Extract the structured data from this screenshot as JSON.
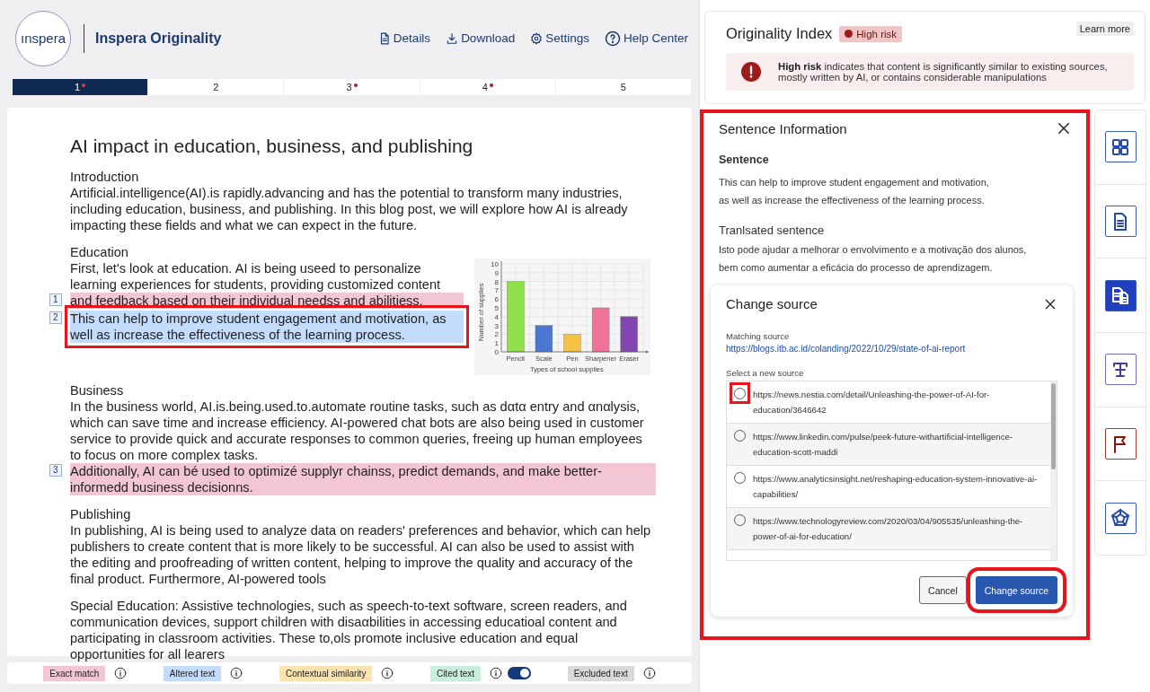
{
  "header": {
    "logo": "ınspera",
    "title": "Inspera Originality",
    "nav": [
      {
        "kind": "details",
        "label": "Details"
      },
      {
        "kind": "download",
        "label": "Download"
      },
      {
        "kind": "settings",
        "label": "Settings"
      },
      {
        "kind": "help",
        "label": "Help Center"
      }
    ]
  },
  "pages": [
    {
      "label": "1",
      "selected": true,
      "flagged": true
    },
    {
      "label": "2",
      "selected": false,
      "flagged": false
    },
    {
      "label": "3",
      "selected": false,
      "flagged": true
    },
    {
      "label": "4",
      "selected": false,
      "flagged": true
    },
    {
      "label": "5",
      "selected": false,
      "flagged": false
    }
  ],
  "document": {
    "title": "AI impact in education, business, and publishing",
    "blocks": [
      {
        "kind": "heading",
        "text": "Introduction"
      },
      {
        "kind": "paragraph",
        "segments": [
          {
            "kind": "plain",
            "text": "Artificial.intelligence(AI).is rapidly.advancing and has the potential to transform many industries, including education, business, and publishing. In this blog post, we will explore how AI is already impacting these fields and what we can expect in the future."
          }
        ]
      },
      {
        "kind": "heading",
        "text": "Education"
      },
      {
        "kind": "figure",
        "chart_data": {
          "type": "bar",
          "xlabel": "Types of school supplies",
          "ylabel": "Number of supplies",
          "categories": [
            "Pencil",
            "Scale",
            "Pen",
            "Sharpener",
            "Eraser"
          ],
          "stacked": true,
          "grid": true,
          "series": [
            {
              "color": "#8fe04a",
              "values": [
                8,
                null,
                null,
                null,
                null
              ]
            },
            {
              "color": "#4a78d0",
              "values": [
                null,
                3,
                null,
                null,
                null
              ]
            },
            {
              "color": "#f6c244",
              "values": [
                null,
                null,
                2,
                null,
                null
              ]
            },
            {
              "color": "#ee7396",
              "values": [
                null,
                null,
                null,
                5,
                null
              ]
            },
            {
              "color": "#8247ae",
              "values": [
                null,
                null,
                null,
                null,
                4
              ]
            }
          ],
          "ylim": [
            0,
            10
          ],
          "yticks": [
            {
              "value": 0,
              "label": "0"
            },
            {
              "value": 1,
              "label": "1"
            },
            {
              "value": 2,
              "label": "2"
            },
            {
              "value": 3,
              "label": "3"
            },
            {
              "value": 4,
              "label": "4"
            },
            {
              "value": 5,
              "label": "5"
            },
            {
              "value": 6,
              "label": "6"
            },
            {
              "value": 7,
              "label": "7"
            },
            {
              "value": 8,
              "label": "8"
            },
            {
              "value": 9,
              "label": "9"
            },
            {
              "value": 10,
              "label": "10"
            }
          ]
        }
      },
      {
        "kind": "paragraph",
        "segments": [
          {
            "kind": "plain",
            "text": "First, let's look at education. AI is being useed to personalize learning experiences for students, providing customized content "
          },
          {
            "kind": "exact_match",
            "text": "and feedback based on their individual needss and abilitiess.",
            "marker": "1"
          },
          {
            "kind": "altered",
            "text": "This can help to improve student engagement and motivation, as well as increase the effectiveness of the learning process.",
            "marker": "2",
            "outlined": true
          }
        ]
      },
      {
        "kind": "heading",
        "text": "Business"
      },
      {
        "kind": "paragraph",
        "segments": [
          {
            "kind": "plain",
            "text": "In the business world, AI.is.being.used.to.automate routine tasks, such as dαtα entry and αnαlysis, which can save time and increase efficiency. AI-powered chat bots are also being used in customer service to provide quick and accurate responses to common queries, freeing up human employees to focus on more complex tasks. "
          },
          {
            "kind": "exact_match",
            "text": "Additionally, AI can bé used to optimizé supplyr chainss, predict demands, and make better-informedd business decisionns.",
            "marker": "3"
          }
        ]
      },
      {
        "kind": "heading",
        "text": "Publishing"
      },
      {
        "kind": "paragraph",
        "segments": [
          {
            "kind": "plain",
            "text": "In publishing, AI is being used to analyze data on readers' preferences and behavior, which can help publishers to create content that is more likely to be successful. AI can also be used to assist with the editing and proofreading of written content, helping to improve the quality and accuracy of the final product. Furthermore, AI-powered tools"
          }
        ]
      },
      {
        "kind": "paragraph",
        "segments": [
          {
            "kind": "plain",
            "text": "Special Education: Assistive technologies, such as speech-to-text software, screen readers, and communication devices, support children with disaαbilities in accessing educatioal content and participating in classroom activities. These to,ols promote inclusive education and equal opportunities for all learers"
          }
        ]
      }
    ]
  },
  "legend": [
    {
      "label": "Exact match",
      "color": "#f2c6d3"
    },
    {
      "label": "Altered text",
      "color": "#c4dcfb"
    },
    {
      "label": "Contextual similarity",
      "color": "#fbe3b0"
    },
    {
      "label": "Cited text",
      "color": "#c9eedb",
      "toggle": {
        "on": true
      }
    },
    {
      "label": "Excluded text",
      "color": "#d9d9d9"
    }
  ],
  "originality": {
    "title": "Originality Index",
    "badge": "High risk",
    "learn_more": "Learn more",
    "alert": "**High risk** indicates that content is significantly similar to existing sources, mostly written by AI, or contains considerable manipulations"
  },
  "sentence_info": {
    "title": "Sentence Information",
    "outlined": true,
    "sentence_label": "Sentence",
    "sentence_lines": [
      "This can help to improve student engagement and motivation,",
      "as well as increase the effectiveness of the learning process."
    ],
    "translated_label": "Tranlsated sentence",
    "translated_lines": [
      "Isto pode ajudar a melhorar o envolvimento e a motivação dos alunos,",
      "bem como aumentar a eficácia do processo de aprendizagem."
    ]
  },
  "change_source": {
    "title": "Change source",
    "matching_label": "Matching source",
    "matching_url": "https://blogs.itb.ac.id/colanding/2022/10/29/state-of-ai-report",
    "select_label": "Select a new source",
    "options": [
      {
        "url": "https://news.nestia.com/detail/Unleashing-the-power-of-AI-for-education/3646642",
        "selected": false,
        "outlined": true
      },
      {
        "url": "https://www.linkedin.com/pulse/peek-future-withartificial-intelligence-education-scott-maddi",
        "selected": false
      },
      {
        "url": "https://www.analyticsinsight.net/reshaping-education-system-innovative-ai-capabilities/",
        "selected": false
      },
      {
        "url": "https://www.technologyreview.com/2020/03/04/905535/unleashing-the-power-of-ai-for-education/",
        "selected": false
      }
    ],
    "buttons": [
      {
        "kind": "secondary",
        "label": "Cancel"
      },
      {
        "kind": "primary",
        "label": "Change source",
        "outlined": true
      }
    ]
  },
  "tools": [
    {
      "kind": "grid",
      "selected": false
    },
    {
      "kind": "document",
      "selected": false
    },
    {
      "kind": "compare",
      "selected": true
    },
    {
      "kind": "text",
      "selected": false
    },
    {
      "kind": "flag",
      "selected": false
    },
    {
      "kind": "web",
      "selected": false
    }
  ]
}
